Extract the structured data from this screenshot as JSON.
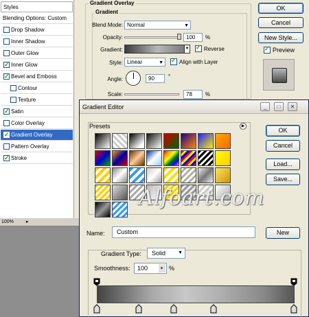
{
  "sidebar": {
    "header": "Styles",
    "items": [
      {
        "label": "Blending Options: Custom",
        "checkbox": false,
        "checked": false,
        "sub": false,
        "selected": false
      },
      {
        "label": "Drop Shadow",
        "checkbox": true,
        "checked": false,
        "sub": false,
        "selected": false
      },
      {
        "label": "Inner Shadow",
        "checkbox": true,
        "checked": false,
        "sub": false,
        "selected": false
      },
      {
        "label": "Outer Glow",
        "checkbox": true,
        "checked": false,
        "sub": false,
        "selected": false
      },
      {
        "label": "Inner Glow",
        "checkbox": true,
        "checked": true,
        "sub": false,
        "selected": false
      },
      {
        "label": "Bevel and Emboss",
        "checkbox": true,
        "checked": true,
        "sub": false,
        "selected": false
      },
      {
        "label": "Contour",
        "checkbox": true,
        "checked": false,
        "sub": true,
        "selected": false
      },
      {
        "label": "Texture",
        "checkbox": true,
        "checked": false,
        "sub": true,
        "selected": false
      },
      {
        "label": "Satin",
        "checkbox": true,
        "checked": true,
        "sub": false,
        "selected": false
      },
      {
        "label": "Color Overlay",
        "checkbox": true,
        "checked": false,
        "sub": false,
        "selected": false
      },
      {
        "label": "Gradient Overlay",
        "checkbox": true,
        "checked": true,
        "sub": false,
        "selected": true
      },
      {
        "label": "Pattern Overlay",
        "checkbox": true,
        "checked": false,
        "sub": false,
        "selected": false
      },
      {
        "label": "Stroke",
        "checkbox": true,
        "checked": true,
        "sub": false,
        "selected": false
      }
    ]
  },
  "status": {
    "zoom": "100%"
  },
  "overlay_panel": {
    "group_title": "Gradient Overlay",
    "sub_title": "Gradient",
    "blend_mode_label": "Blend Mode:",
    "blend_mode_value": "Normal",
    "opacity_label": "Opacity:",
    "opacity_value": "100",
    "opacity_pct": "%",
    "gradient_label": "Gradient:",
    "reverse_label": "Reverse",
    "reverse_checked": true,
    "style_label": "Style:",
    "style_value": "Linear",
    "align_label": "Align with Layer",
    "align_checked": true,
    "angle_label": "Angle:",
    "angle_value": "90",
    "angle_unit": "°",
    "scale_label": "Scale:",
    "scale_value": "78",
    "scale_pct": "%"
  },
  "dialog_buttons": {
    "ok": "OK",
    "cancel": "Cancel",
    "new_style": "New Style...",
    "preview_label": "Preview",
    "preview_checked": true
  },
  "gradient_editor": {
    "title": "Gradient Editor",
    "window_buttons": {
      "minimize": "_",
      "maximize": "□",
      "close": "✕"
    },
    "presets_title": "Presets",
    "watermark": "Alfoart.com",
    "ok": "OK",
    "cancel": "Cancel",
    "load": "Load...",
    "save": "Save...",
    "name_label": "Name:",
    "name_value": "Custom",
    "new_button": "New",
    "gradient_type_label": "Gradient Type:",
    "gradient_type_value": "Solid",
    "smoothness_label": "Smoothness:",
    "smoothness_value": "100",
    "smoothness_pct": "%"
  }
}
